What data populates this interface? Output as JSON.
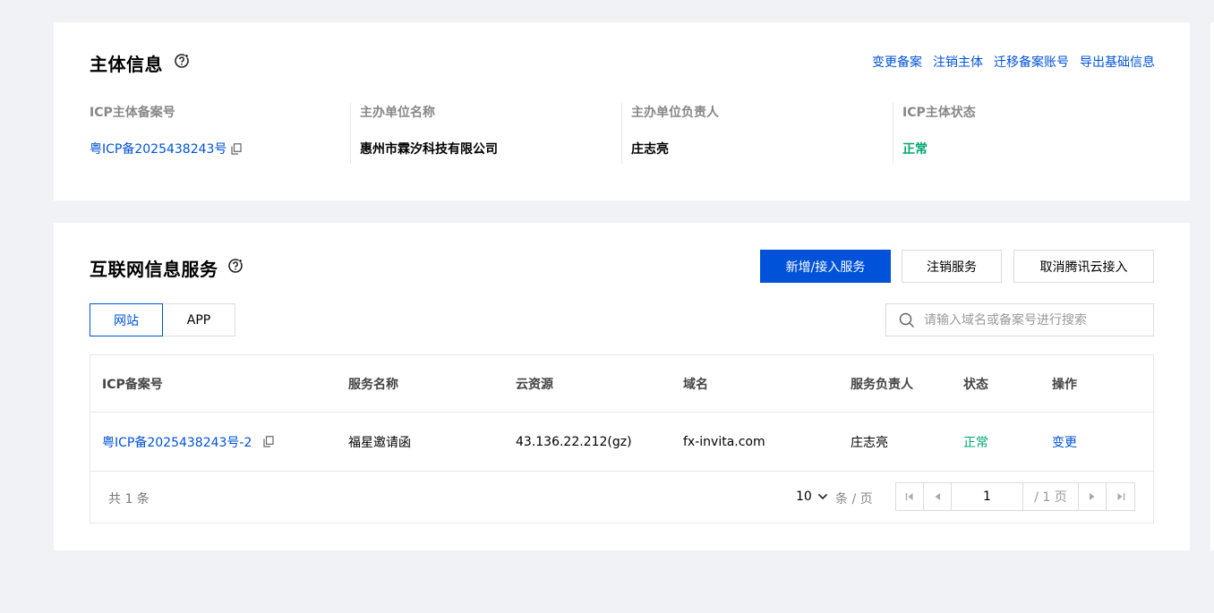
{
  "entity": {
    "title": "主体信息",
    "links": [
      "变更备案",
      "注销主体",
      "迁移备案账号",
      "导出基础信息"
    ],
    "fields": [
      {
        "label": "ICP主体备案号",
        "value": "粤ICP备2025438243号"
      },
      {
        "label": "主办单位名称",
        "value": "惠州市霖汐科技有限公司"
      },
      {
        "label": "主办单位负责人",
        "value": "庄志亮"
      },
      {
        "label": "ICP主体状态",
        "value": "正常"
      }
    ]
  },
  "services": {
    "title": "互联网信息服务",
    "buttons": {
      "add": "新增/接入服务",
      "cancel": "注销服务",
      "remove": "取消腾讯云接入"
    },
    "tabs": [
      "网站",
      "APP"
    ],
    "search_placeholder": "请输入域名或备案号进行搜索",
    "columns": [
      "ICP备案号",
      "服务名称",
      "云资源",
      "域名",
      "服务负责人",
      "状态",
      "操作"
    ],
    "rows": [
      {
        "icp": "粤ICP备2025438243号-2",
        "name": "福星邀请函",
        "resource": "43.136.22.212(gz)",
        "domain": "fx-invita.com",
        "owner": "庄志亮",
        "status": "正常",
        "action": "变更"
      }
    ],
    "footer": {
      "total": "共 1 条",
      "page_size": "10",
      "page_size_unit": "条 / 页",
      "current_page": "1",
      "total_pages": "/ 1 页"
    }
  },
  "colors": {
    "primary": "#0052d9",
    "success": "#00a870"
  }
}
